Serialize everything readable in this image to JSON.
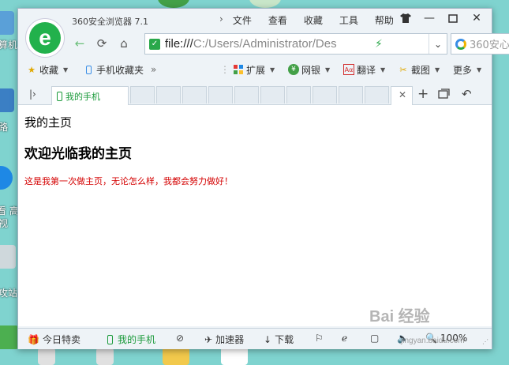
{
  "desktop": {
    "labels": [
      "算机",
      "路",
      "看 高",
      "视",
      "攻站"
    ]
  },
  "window": {
    "title": "360安全浏览器 7.1",
    "menu": [
      "文件",
      "查看",
      "收藏",
      "工具",
      "帮助"
    ]
  },
  "address": {
    "url_main": "file:///",
    "url_rest": "C:/Users/Administrator/Des",
    "search_placeholder": "360安心"
  },
  "bookmarks": {
    "favorites": "收藏",
    "mobile_favs": "手机收藏夹",
    "more_chevron": "»",
    "extensions": "扩展",
    "netbank": "网银",
    "translate": "翻译",
    "screenshot": "截图",
    "more": "更多"
  },
  "tabs": {
    "active_label": "我的手机"
  },
  "page": {
    "title_line": "我的主页",
    "heading": "欢迎光临我的主页",
    "paragraph": "这是我第一次做主页，无论怎么样，我都会努力做好！"
  },
  "statusbar": {
    "deals": "今日特卖",
    "my_phone": "我的手机",
    "accelerator": "加速器",
    "download": "下载",
    "zoom": "100%"
  },
  "watermark": "Bai 经验",
  "watermark_url": "jingyan.baidu.com",
  "colors": {
    "accent_green": "#22b14c",
    "desktop_bg": "#7fd3cf",
    "paragraph_red": "#d40000"
  }
}
